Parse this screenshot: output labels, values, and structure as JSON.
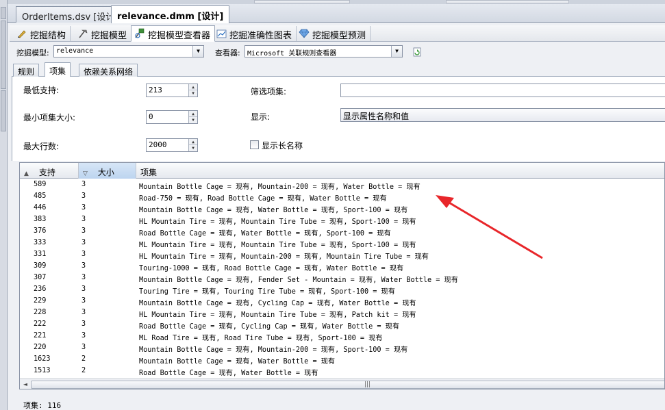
{
  "document_tabs": [
    {
      "label": "OrderItems.dsv [设计]",
      "active": false
    },
    {
      "label": "relevance.dmm [设计]",
      "active": true
    }
  ],
  "designer_tabs": [
    {
      "label": "挖掘结构",
      "icon": "mining-structure-icon"
    },
    {
      "label": "挖掘模型",
      "icon": "mining-model-icon"
    },
    {
      "label": "挖掘模型查看器",
      "icon": "model-viewer-icon",
      "active": true
    },
    {
      "label": "挖掘准确性图表",
      "icon": "accuracy-chart-icon"
    },
    {
      "label": "挖掘模型预测",
      "icon": "prediction-gem-icon"
    }
  ],
  "viewer_bar": {
    "model_label": "挖掘模型:",
    "model_value": "relevance",
    "viewer_label": "查看器:",
    "viewer_value": "Microsoft 关联规则查看器",
    "refresh_icon": "refresh-icon"
  },
  "sub_tabs": [
    {
      "label": "规则"
    },
    {
      "label": "项集",
      "active": true
    },
    {
      "label": "依赖关系网络"
    }
  ],
  "settings": {
    "min_support_label": "最低支持:",
    "min_support_value": "213",
    "min_itemset_size_label": "最小项集大小:",
    "min_itemset_size_value": "0",
    "max_rows_label": "最大行数:",
    "max_rows_value": "2000",
    "filter_itemset_label": "筛选项集:",
    "filter_itemset_value": "",
    "display_label": "显示:",
    "display_value": "显示属性名称和值",
    "show_long_name_label": "显示长名称",
    "show_long_name_checked": false
  },
  "grid": {
    "columns": [
      {
        "label": "支持",
        "sort": "asc"
      },
      {
        "label": "大小",
        "sort": "desc"
      },
      {
        "label": "项集",
        "sort": ""
      }
    ],
    "rows": [
      {
        "support": "589",
        "size": "3",
        "itemset": "Mountain Bottle Cage = 现有, Mountain-200 = 现有, Water Bottle = 现有"
      },
      {
        "support": "485",
        "size": "3",
        "itemset": "Road-750 = 现有, Road Bottle Cage = 现有, Water Bottle = 现有"
      },
      {
        "support": "446",
        "size": "3",
        "itemset": "Mountain Bottle Cage = 现有, Water Bottle = 现有, Sport-100 = 现有"
      },
      {
        "support": "383",
        "size": "3",
        "itemset": "HL Mountain Tire = 现有, Mountain Tire Tube = 现有, Sport-100 = 现有"
      },
      {
        "support": "376",
        "size": "3",
        "itemset": "Road Bottle Cage = 现有, Water Bottle = 现有, Sport-100 = 现有"
      },
      {
        "support": "333",
        "size": "3",
        "itemset": "ML Mountain Tire = 现有, Mountain Tire Tube = 现有, Sport-100 = 现有"
      },
      {
        "support": "331",
        "size": "3",
        "itemset": "HL Mountain Tire = 现有, Mountain-200 = 现有, Mountain Tire Tube = 现有"
      },
      {
        "support": "309",
        "size": "3",
        "itemset": "Touring-1000 = 现有, Road Bottle Cage = 现有, Water Bottle = 现有"
      },
      {
        "support": "307",
        "size": "3",
        "itemset": "Mountain Bottle Cage = 现有, Fender Set - Mountain = 现有, Water Bottle = 现有"
      },
      {
        "support": "236",
        "size": "3",
        "itemset": "Touring Tire = 现有, Touring Tire Tube = 现有, Sport-100 = 现有"
      },
      {
        "support": "229",
        "size": "3",
        "itemset": "Mountain Bottle Cage = 现有, Cycling Cap = 现有, Water Bottle = 现有"
      },
      {
        "support": "228",
        "size": "3",
        "itemset": "HL Mountain Tire = 现有, Mountain Tire Tube = 现有, Patch kit = 现有"
      },
      {
        "support": "222",
        "size": "3",
        "itemset": "Road Bottle Cage = 现有, Cycling Cap = 现有, Water Bottle = 现有"
      },
      {
        "support": "221",
        "size": "3",
        "itemset": "ML Road Tire = 现有, Road Tire Tube = 现有, Sport-100 = 现有"
      },
      {
        "support": "220",
        "size": "3",
        "itemset": "Mountain Bottle Cage = 现有, Mountain-200 = 现有, Sport-100 = 现有"
      },
      {
        "support": "1623",
        "size": "2",
        "itemset": "Mountain Bottle Cage = 现有, Water Bottle = 现有"
      },
      {
        "support": "1513",
        "size": "2",
        "itemset": "Road Bottle Cage = 现有, Water Bottle = 现有"
      }
    ]
  },
  "status": {
    "itemset_count_text": "项集: 116"
  },
  "colors": {
    "annotation_arrow": "#e8262a",
    "sorted_header": "#bcd4ef"
  }
}
